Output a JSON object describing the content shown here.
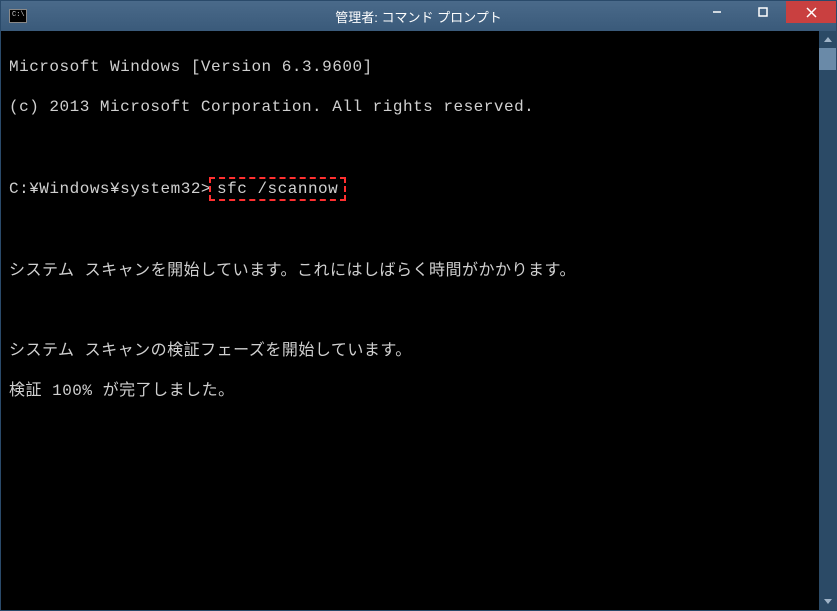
{
  "window": {
    "title": "管理者: コマンド プロンプト",
    "icon_text": "C:\\"
  },
  "terminal": {
    "line1": "Microsoft Windows [Version 6.3.9600]",
    "line2": "(c) 2013 Microsoft Corporation. All rights reserved.",
    "prompt": "C:¥Windows¥system32>",
    "command": "sfc /scannow",
    "msg1": "システム スキャンを開始しています。これにはしばらく時間がかかります。",
    "msg2": "システム スキャンの検証フェーズを開始しています。",
    "msg3": "検証 100% が完了しました。"
  }
}
